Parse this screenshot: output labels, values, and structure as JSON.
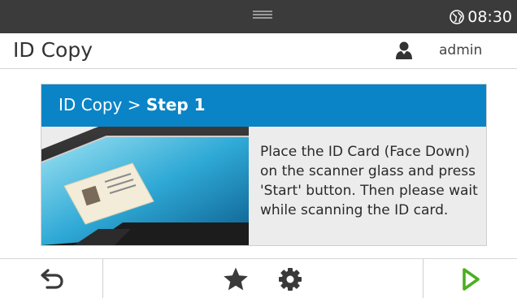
{
  "status_bar": {
    "time": "08:30"
  },
  "header": {
    "title": "ID Copy",
    "user": "admin"
  },
  "card": {
    "title_prefix": "ID Copy > ",
    "title_step": "Step 1",
    "instructions": "Place the ID Card (Face Down) on the scanner glass and press 'Start' button. Then please wait while scanning the ID card."
  },
  "toolbar": {
    "icons": [
      "back-icon",
      "star-icon",
      "gear-icon",
      "start-icon"
    ]
  },
  "colors": {
    "status_bar_bg": "#3b3b3b",
    "card_header_bg": "#0a84c6",
    "start_green": "#4caf21"
  }
}
